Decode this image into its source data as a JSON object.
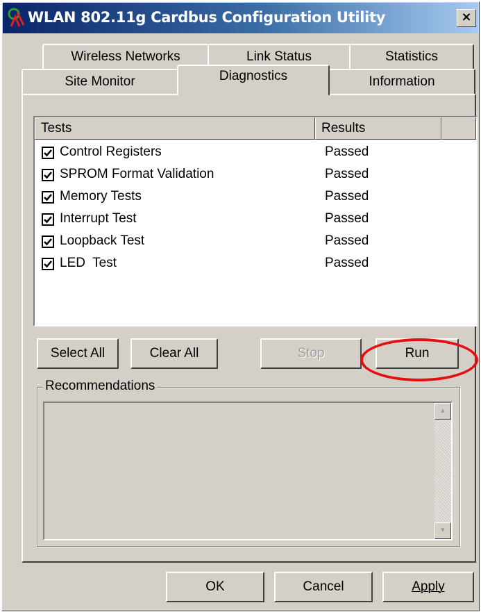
{
  "window": {
    "title": "WLAN 802.11g Cardbus Configuration Utility",
    "close_glyph": "×"
  },
  "tabs": {
    "row1": [
      {
        "label": "Wireless Networks"
      },
      {
        "label": "Link Status"
      },
      {
        "label": "Statistics"
      }
    ],
    "row2": [
      {
        "label": "Site Monitor"
      },
      {
        "label": "Diagnostics",
        "active": true
      },
      {
        "label": "Information"
      }
    ]
  },
  "diagnostics": {
    "columns": {
      "tests": "Tests",
      "results": "Results"
    },
    "tests": [
      {
        "name": "Control Registers",
        "checked": true,
        "result": "Passed"
      },
      {
        "name": "SPROM Format Validation",
        "checked": true,
        "result": "Passed"
      },
      {
        "name": "Memory Tests",
        "checked": true,
        "result": "Passed"
      },
      {
        "name": "Interrupt Test",
        "checked": true,
        "result": "Passed"
      },
      {
        "name": "Loopback Test",
        "checked": true,
        "result": "Passed"
      },
      {
        "name": "LED  Test",
        "checked": true,
        "result": "Passed"
      }
    ],
    "buttons": {
      "select_all": "Select All",
      "clear_all": "Clear All",
      "stop": "Stop",
      "run": "Run"
    },
    "recommendations_label": "Recommendations",
    "recommendations_text": ""
  },
  "footer": {
    "ok": "OK",
    "cancel": "Cancel",
    "apply": "Apply"
  },
  "colors": {
    "annotation": "#e41010",
    "titlebar": "#0a246a",
    "face": "#d4d0c8"
  }
}
